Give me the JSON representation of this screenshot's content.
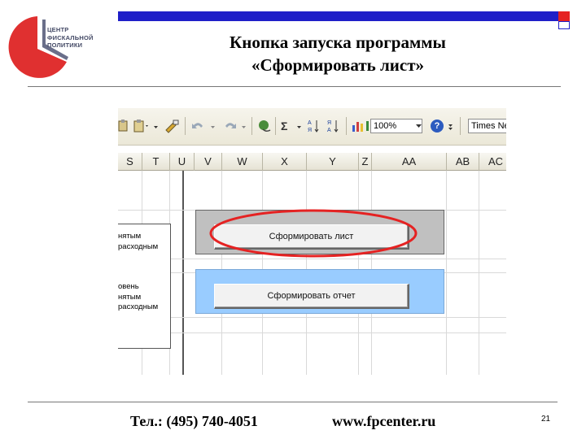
{
  "colors": {
    "accent_blue": "#1f1fc8",
    "accent_red": "#e52222",
    "highlight_ellipse": "#e52222",
    "panel_gray": "#c0c0c0",
    "panel_blue": "#99ccff"
  },
  "logo": {
    "lines": [
      "ЦЕНТР",
      "ФИСКАЛЬНОЙ",
      "ПОЛИТИКИ"
    ]
  },
  "title": {
    "line1": "Кнопка запуска программы",
    "line2": "«Сформировать лист»"
  },
  "toolbar": {
    "icons": [
      "paste-icon",
      "format-painter-icon",
      "undo-icon",
      "redo-icon",
      "hyperlink-icon",
      "autosum-icon",
      "sort-asc-icon",
      "sort-desc-icon",
      "chart-icon",
      "drawing-icon",
      "help-icon"
    ],
    "sum_label": "Σ",
    "zoom": "100%",
    "font": "Times Ne"
  },
  "columns": [
    "S",
    "T",
    "U",
    "V",
    "W",
    "X",
    "Y",
    "Z",
    "AA",
    "AB",
    "AC"
  ],
  "row_labels": [
    "нятым",
    "расходным",
    "",
    "",
    "овень",
    "нятым",
    "расходным"
  ],
  "buttons": {
    "form_sheet": "Сформировать лист",
    "form_report": "Сформировать отчет"
  },
  "footer": {
    "phone": "Тел.: (495) 740-4051",
    "website": "www.fpcenter.ru",
    "page_number": "21"
  }
}
